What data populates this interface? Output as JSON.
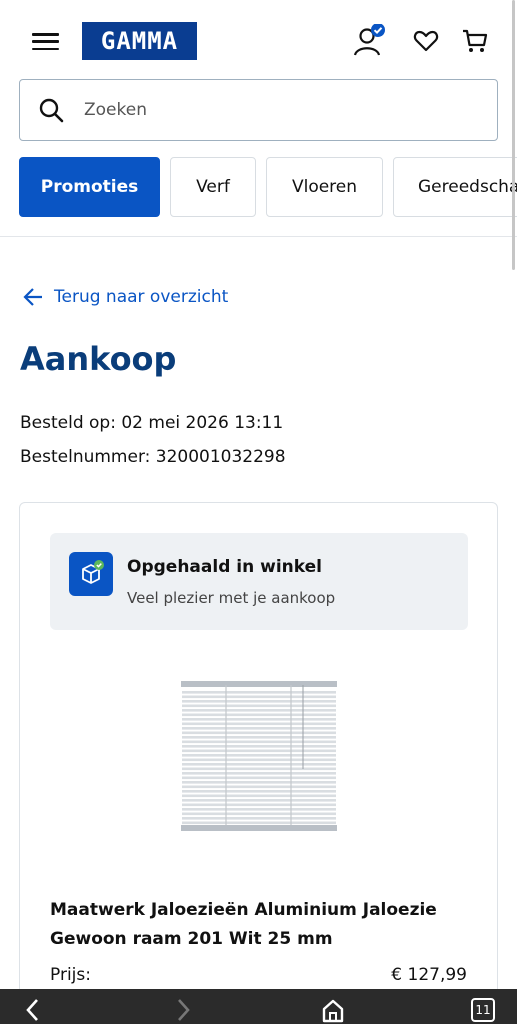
{
  "header": {
    "logo_text": "GAMMA",
    "brand_color": "#0a3d91",
    "accent_color": "#0a55c4",
    "icons": [
      "menu-icon",
      "account-icon",
      "heart-icon",
      "cart-icon"
    ]
  },
  "search": {
    "placeholder": "Zoeken",
    "value": ""
  },
  "categories": [
    {
      "label": "Promoties",
      "active": true
    },
    {
      "label": "Verf",
      "active": false
    },
    {
      "label": "Vloeren",
      "active": false
    },
    {
      "label": "Gereedschap",
      "active": false
    }
  ],
  "back_link": "Terug naar overzicht",
  "page_title": "Aankoop",
  "order": {
    "date_line": "Besteld op: 02 mei 2026 13:11",
    "number_line": "Bestelnummer: 320001032298"
  },
  "status": {
    "title": "Opgehaald in winkel",
    "subtitle": "Veel plezier met je aankoop"
  },
  "product": {
    "name": "Maatwerk Jaloezieën Aluminium Jaloezie Gewoon raam 201 Wit 25 mm",
    "price_label": "Prijs:",
    "price_value": "€ 127,99"
  },
  "browser": {
    "tab_count": "11"
  }
}
